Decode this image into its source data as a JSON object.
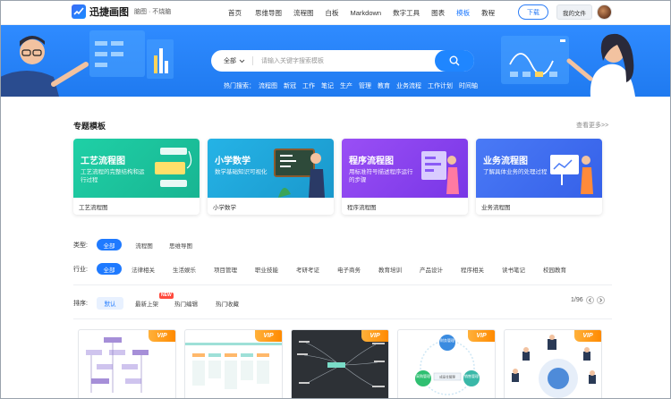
{
  "app": {
    "name": "迅捷画图",
    "slogan": "脑图 · 不烧脑"
  },
  "nav": {
    "items": [
      "首页",
      "思维导图",
      "流程图",
      "白板",
      "Markdown",
      "数字工具",
      "图表",
      "模板",
      "教程"
    ],
    "active": "模板",
    "download_label": "下载",
    "my_files_label": "我的文件"
  },
  "search": {
    "scope": "全部",
    "placeholder": "请输入关键字搜索模板",
    "hot_label": "热门搜索：",
    "hot_terms": [
      "流程图",
      "新冠",
      "工作",
      "笔记",
      "生产",
      "管理",
      "教育",
      "业务流程",
      "工作计划",
      "时间轴"
    ]
  },
  "special": {
    "title": "专题模板",
    "see_more": "查看更多>>",
    "cards": [
      {
        "title": "工艺流程图",
        "desc": "工艺流程的完整结构和运行过程",
        "caption": "工艺流程图",
        "color": "#23c4a0"
      },
      {
        "title": "小学数学",
        "desc": "数学基础知识可视化",
        "caption": "小学数学",
        "color": "#1fa7d8"
      },
      {
        "title": "程序流程图",
        "desc": "用标准符号描述程序运行的步骤",
        "caption": "程序流程图",
        "color": "#8b44f0"
      },
      {
        "title": "业务流程图",
        "desc": "了解具体业务的处理过程",
        "caption": "业务流程图",
        "color": "#3d6af2"
      }
    ]
  },
  "filters": {
    "type_label": "类型:",
    "type_options": [
      "全部",
      "流程图",
      "思维导图"
    ],
    "industry_label": "行业:",
    "industry_options": [
      "全部",
      "法律相关",
      "生活娱乐",
      "项目管理",
      "职业技能",
      "考研考证",
      "电子商务",
      "教育培训",
      "产品设计",
      "程序相关",
      "读书笔记",
      "校园教育"
    ]
  },
  "sort": {
    "label": "排序:",
    "options": [
      "默认",
      "最新上架",
      "热门编辑",
      "热门收藏"
    ],
    "new_badge": "NEW",
    "page": "1/96"
  },
  "thumbs": {
    "vip_label": "VIP",
    "items": [
      {
        "name": "flowchart-template"
      },
      {
        "name": "timeline-template"
      },
      {
        "name": "mindmap-dark-template"
      },
      {
        "name": "circular-template",
        "nodes": [
          "财务管理",
          "采购管理",
          "销售管理",
          "成品仓管理"
        ]
      },
      {
        "name": "org-chart-template"
      }
    ]
  },
  "colors": {
    "accent": "#1f7aff",
    "banner": "#2584f8",
    "vip": "#ff9a1f"
  }
}
